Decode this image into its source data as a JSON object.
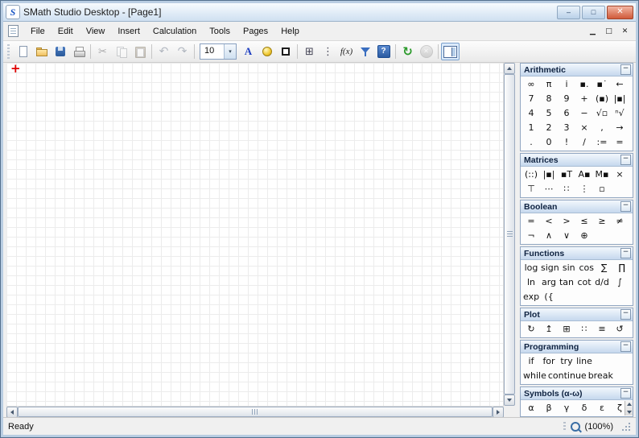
{
  "window": {
    "title": "SMath Studio Desktop - [Page1]",
    "logo": "S",
    "minimize": "–",
    "maximize": "□",
    "close": "✕"
  },
  "menubar": {
    "items": [
      "File",
      "Edit",
      "View",
      "Insert",
      "Calculation",
      "Tools",
      "Pages",
      "Help"
    ],
    "minimize": "▁",
    "restore": "□",
    "close": "✕"
  },
  "toolbar": {
    "font_size": "10",
    "dropdown": "▾",
    "cut": "✂",
    "undo": "↶",
    "redo": "↷",
    "font_color": "A",
    "matrix": "⊞",
    "system": "⋮",
    "function": "f(x)",
    "reference": "?",
    "recalculate": "↻",
    "interrupt": "✕"
  },
  "canvas": {
    "cursor": "+"
  },
  "statusbar": {
    "status": "Ready",
    "zoom": "(100%)"
  },
  "sidebar": {
    "collapse": "−",
    "panels": [
      {
        "title": "Arithmetic",
        "rows": [
          [
            "∞",
            "π",
            "i",
            "▪.",
            "▪˙",
            "←"
          ],
          [
            "7",
            "8",
            "9",
            "+",
            "(▪)",
            "|▪|"
          ],
          [
            "4",
            "5",
            "6",
            "−",
            "√▫",
            "ⁿ√"
          ],
          [
            "1",
            "2",
            "3",
            "×",
            ",",
            "→"
          ],
          [
            ".",
            "0",
            "!",
            "/",
            ":=",
            "="
          ]
        ]
      },
      {
        "title": "Matrices",
        "rows": [
          [
            "(::)",
            "|▪|",
            "▪T",
            "A▪",
            "M▪",
            "×"
          ],
          [
            "⊤",
            "⋯",
            "∷",
            "⋮",
            "▫"
          ]
        ]
      },
      {
        "title": "Boolean",
        "rows": [
          [
            "=",
            "<",
            ">",
            "≤",
            "≥",
            "≠"
          ],
          [
            "¬",
            "∧",
            "∨",
            "⊕"
          ]
        ]
      },
      {
        "title": "Functions",
        "rows": [
          [
            "log",
            "sign",
            "sin",
            "cos",
            "∑",
            "∏"
          ],
          [
            "ln",
            "arg",
            "tan",
            "cot",
            "d/d",
            "∫"
          ],
          [
            "exp",
            "({"
          ]
        ]
      },
      {
        "title": "Plot",
        "rows": [
          [
            "↻",
            "↥",
            "⊞",
            "∷",
            "≡",
            "↺"
          ]
        ]
      },
      {
        "title": "Programming",
        "rows": [
          [
            "if",
            "for",
            "try",
            "line"
          ],
          [
            "while",
            "continue",
            "break"
          ]
        ]
      },
      {
        "title": "Symbols (α-ω)",
        "rows": [
          [
            "α",
            "β",
            "γ",
            "δ",
            "ε",
            "ζ"
          ]
        ],
        "has_scroll": true
      }
    ]
  }
}
